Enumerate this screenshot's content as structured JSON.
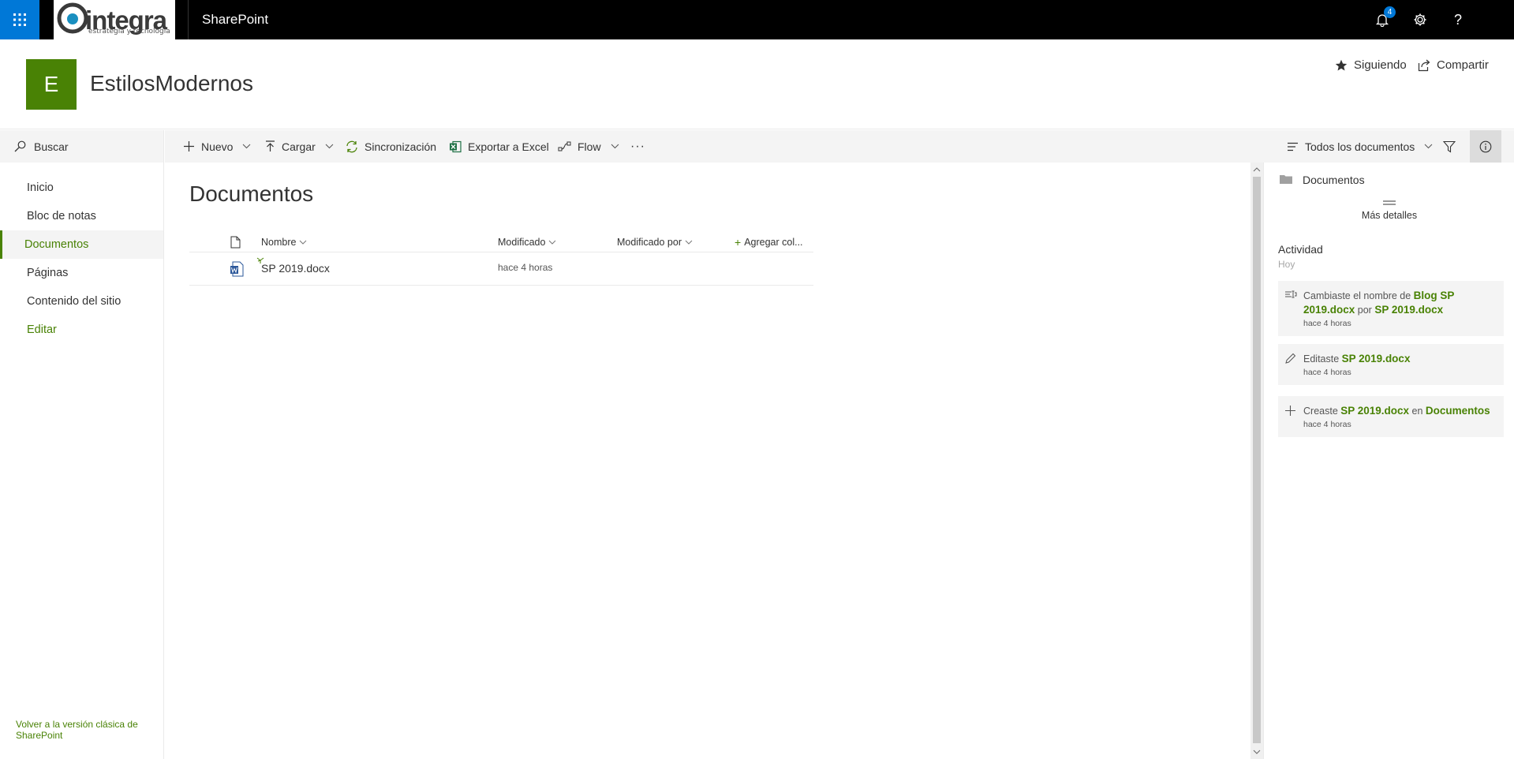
{
  "suite": {
    "app_name": "SharePoint",
    "logo_text": "integra",
    "logo_tagline": "estrategia y tecnologia",
    "notification_count": "4"
  },
  "site": {
    "logo_letter": "E",
    "title": "EstilosModernos",
    "follow_label": "Siguiendo",
    "share_label": "Compartir"
  },
  "search": {
    "placeholder": "Buscar"
  },
  "nav": {
    "items": [
      {
        "label": "Inicio"
      },
      {
        "label": "Bloc de notas"
      },
      {
        "label": "Documentos"
      },
      {
        "label": "Páginas"
      },
      {
        "label": "Contenido del sitio"
      },
      {
        "label": "Editar"
      }
    ],
    "footer": "Volver a la versión clásica de SharePoint"
  },
  "cmdbar": {
    "new": "Nuevo",
    "upload": "Cargar",
    "sync": "Sincronización",
    "export": "Exportar a Excel",
    "flow": "Flow",
    "more": "···",
    "view": "Todos los documentos"
  },
  "library": {
    "title": "Documentos",
    "columns": {
      "name": "Nombre",
      "modified": "Modificado",
      "modified_by": "Modificado por",
      "add_column": "Agregar col..."
    },
    "rows": [
      {
        "name": "SP 2019.docx",
        "modified": "hace 4 horas",
        "modified_by": ""
      }
    ]
  },
  "pane": {
    "title": "Documentos",
    "more_details": "Más detalles",
    "activity_title": "Actividad",
    "activity_sub": "Hoy",
    "activities": [
      {
        "pre": "Cambiaste el nombre de ",
        "link1": "Blog SP 2019.docx",
        "mid": " por ",
        "link2": "SP 2019.docx",
        "time": "hace 4 horas"
      },
      {
        "pre": "Editaste ",
        "link1": "SP 2019.docx",
        "time": "hace 4 horas"
      },
      {
        "pre": "Creaste ",
        "link1": "SP 2019.docx",
        "mid": " en ",
        "link2": "Documentos",
        "time": "hace 4 horas"
      }
    ]
  },
  "colors": {
    "brand_green": "#498205",
    "suite_black": "#000000",
    "waffle_blue": "#0078d7"
  }
}
